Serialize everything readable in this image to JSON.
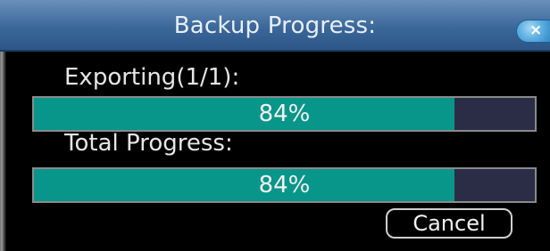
{
  "dialog": {
    "title": "Backup Progress:",
    "close_glyph": "×"
  },
  "current_file": {
    "label": "Exporting(1/1):",
    "progress_percent": 84,
    "progress_text": "84%"
  },
  "total": {
    "label": "Total Progress:",
    "progress_percent": 84,
    "progress_text": "84%"
  },
  "actions": {
    "cancel_label": "Cancel"
  },
  "colors": {
    "titlebar": "#3a6699",
    "progress_fill": "#08968a",
    "progress_track": "#2a2d45",
    "background": "#000000"
  }
}
